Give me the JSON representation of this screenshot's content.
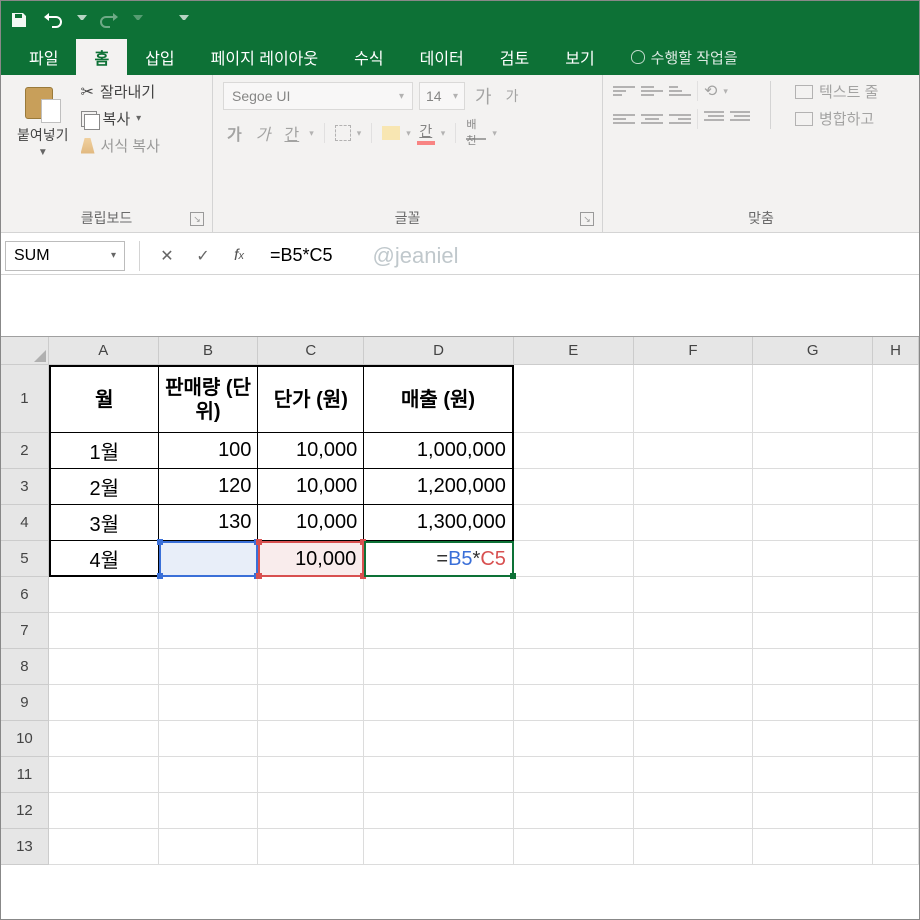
{
  "qat": {
    "save": "save-icon",
    "undo": "undo-icon",
    "redo": "redo-icon"
  },
  "tabs": {
    "items": [
      "파일",
      "홈",
      "삽입",
      "페이지 레이아웃",
      "수식",
      "데이터",
      "검토",
      "보기"
    ],
    "tellme": "수행할 작업을",
    "active": "홈"
  },
  "ribbon": {
    "clipboard": {
      "label": "클립보드",
      "paste": "붙여넣기",
      "cut": "잘라내기",
      "copy": "복사",
      "fmt": "서식 복사"
    },
    "font": {
      "label": "글꼴",
      "name": "Segoe UI",
      "size": "14"
    },
    "align": {
      "label": "맞춤",
      "wrap": "텍스트 줄",
      "merge": "병합하고"
    }
  },
  "namebox": "SUM",
  "formula": "=B5*C5",
  "watermark": "@jeaniel",
  "columns": [
    "A",
    "B",
    "C",
    "D",
    "E",
    "F",
    "G",
    "H"
  ],
  "row_numbers": [
    1,
    2,
    3,
    4,
    5,
    6,
    7,
    8,
    9,
    10,
    11,
    12,
    13
  ],
  "table": {
    "headers": {
      "A": "월",
      "B": "판매량 (단위)",
      "C": "단가 (원)",
      "D": "매출 (원)"
    },
    "rows": [
      {
        "A": "1월",
        "B": "100",
        "C": "10,000",
        "D": "1,000,000"
      },
      {
        "A": "2월",
        "B": "120",
        "C": "10,000",
        "D": "1,200,000"
      },
      {
        "A": "3월",
        "B": "130",
        "C": "10,000",
        "D": "1,300,000"
      },
      {
        "A": "4월",
        "B": "",
        "C": "10,000",
        "D_formula": {
          "eq": "=",
          "b": "B5",
          "op": "*",
          "c": "C5"
        }
      }
    ]
  }
}
